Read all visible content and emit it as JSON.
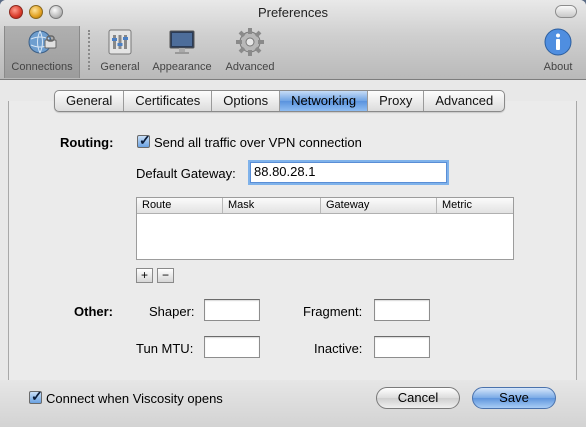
{
  "window": {
    "title": "Preferences"
  },
  "toolbar": {
    "items": [
      {
        "label": "Connections",
        "icon": "connections-icon"
      },
      {
        "label": "General",
        "icon": "general-icon"
      },
      {
        "label": "Appearance",
        "icon": "appearance-icon"
      },
      {
        "label": "Advanced",
        "icon": "advanced-gear-icon"
      },
      {
        "label": "About",
        "icon": "info-icon"
      }
    ],
    "selected": "Connections"
  },
  "tabs": [
    "General",
    "Certificates",
    "Options",
    "Networking",
    "Proxy",
    "Advanced"
  ],
  "active_tab": "Networking",
  "routing": {
    "label": "Routing:",
    "send_all_traffic": {
      "label": "Send all traffic over VPN connection",
      "checked": true
    },
    "default_gateway_label": "Default Gateway:",
    "default_gateway_value": "88.80.28.1",
    "table_columns": [
      "Route",
      "Mask",
      "Gateway",
      "Metric"
    ],
    "table_rows": [],
    "add_label": "+",
    "remove_label": "−"
  },
  "other": {
    "label": "Other:",
    "shaper_label": "Shaper:",
    "shaper_value": "",
    "fragment_label": "Fragment:",
    "fragment_value": "",
    "tun_mtu_label": "Tun MTU:",
    "tun_mtu_value": "",
    "inactive_label": "Inactive:",
    "inactive_value": ""
  },
  "footer": {
    "connect_on_open": {
      "label": "Connect when Viscosity opens",
      "checked": true
    },
    "cancel_label": "Cancel",
    "save_label": "Save"
  },
  "colors": {
    "accent": "#6aa2e2",
    "selected_tab": "#5a93de",
    "window_bg": "#e8e8e8"
  }
}
